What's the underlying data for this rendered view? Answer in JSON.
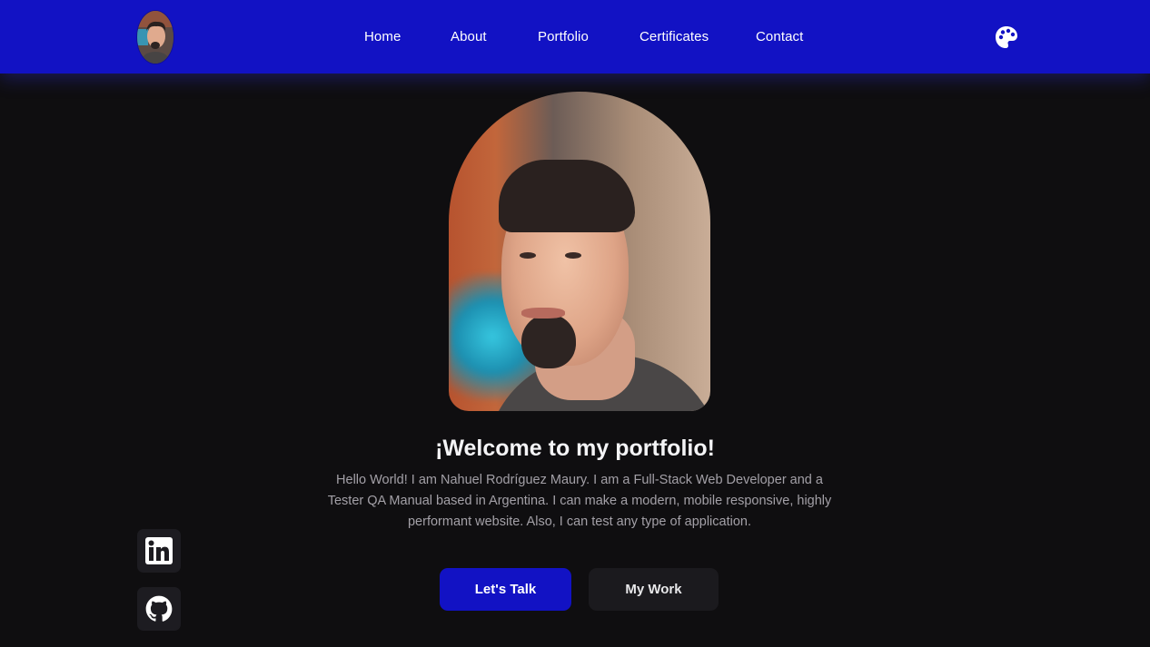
{
  "header": {
    "logo_alt": "profile avatar",
    "nav": [
      {
        "label": "Home"
      },
      {
        "label": "About"
      },
      {
        "label": "Portfolio"
      },
      {
        "label": "Certificates"
      },
      {
        "label": "Contact"
      }
    ],
    "theme_icon": "palette-icon"
  },
  "hero": {
    "title": "¡Welcome to my portfolio!",
    "description": "Hello World! I am Nahuel Rodríguez Maury. I am a Full-Stack Web Developer and a Tester QA Manual based in Argentina. I can make a modern, mobile responsive, highly performant website. Also, I can test any type of application.",
    "primary_button": "Let's Talk",
    "secondary_button": "My Work"
  },
  "social": {
    "items": [
      {
        "icon": "linkedin-icon"
      },
      {
        "icon": "github-icon"
      }
    ]
  },
  "colors": {
    "accent": "#1212c4",
    "background": "#0f0e10",
    "surface": "#1b1a1e",
    "text_muted": "#a3a0a7"
  }
}
